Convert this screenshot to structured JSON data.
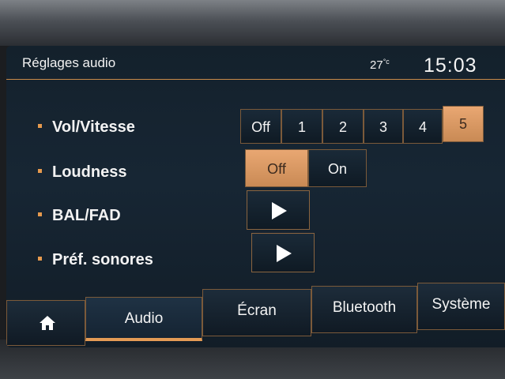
{
  "header": {
    "title": "Réglages audio",
    "temperature": "27",
    "temperature_unit": "°c",
    "clock": "15:03"
  },
  "settings": {
    "vol_vitesse": {
      "label": "Vol/Vitesse",
      "options": [
        "Off",
        "1",
        "2",
        "3",
        "4",
        "5"
      ],
      "selected": "5"
    },
    "loudness": {
      "label": "Loudness",
      "options": [
        "Off",
        "On"
      ],
      "selected": "Off"
    },
    "bal_fad": {
      "label": "BAL/FAD",
      "icon": "play-arrow-icon"
    },
    "pref_sonores": {
      "label": "Préf. sonores",
      "icon": "play-arrow-icon"
    }
  },
  "tabs": {
    "home_icon": "home-icon",
    "items": [
      "Audio",
      "Écran",
      "Bluetooth",
      "Système"
    ],
    "active": "Audio"
  },
  "colors": {
    "accent": "#e39a55",
    "screen_bg": "#14212c",
    "text": "#f4f4f4"
  }
}
